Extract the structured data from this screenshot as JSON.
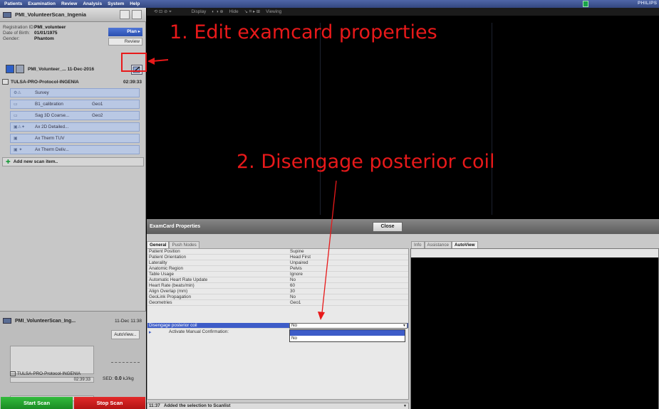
{
  "menubar": {
    "items": [
      "Patients",
      "Examination",
      "Review",
      "Analysis",
      "System",
      "Help"
    ],
    "brand": "PHILIPS"
  },
  "patient_tab": {
    "name": "PMI_VolunteerScan_Ingenia"
  },
  "registration": {
    "id_label": "Registration ID:",
    "id_value": "PMI_volunteer",
    "dob_label": "Date of Birth:",
    "dob_value": "01/01/1975",
    "gender_label": "Gender:",
    "gender_value": "Phantom"
  },
  "plan_button": "Plan ▸",
  "review_button": "Review",
  "examcard": {
    "name": "PMI_Volunteer_... 11-Dec-2016"
  },
  "protocol": {
    "name": "TULSA-PRO-Protocol-INGENIA",
    "time": "02:39:33"
  },
  "scan_items": [
    {
      "icons": "⚙⚠",
      "name": "Survey",
      "geo": ""
    },
    {
      "icons": "▭",
      "name": "B1_calibration",
      "geo": "Geo1"
    },
    {
      "icons": "▭",
      "name": "Sag 3D Coarse...",
      "geo": "Geo2"
    },
    {
      "icons": "▣⚠✦",
      "name": "Ax 2D Detailed...",
      "geo": ""
    },
    {
      "icons": "▣",
      "name": "Ax Therm TUV",
      "geo": ""
    },
    {
      "icons": "▣ ✦",
      "name": "Ax Therm Deliv...",
      "geo": ""
    }
  ],
  "add_scan_item": "Add new scan item..",
  "lower_panel": {
    "title": "PMI_VolunteerScan_Ing...",
    "time": "11-Dec 11:38",
    "autoview": "AutoView...",
    "protocol": "TULSA-PRO-Protocol-INGENIA",
    "bar_time": "02:39:33",
    "sed_label": "SED:",
    "sed_value": "0.0",
    "sed_unit": "kJ/kg"
  },
  "start_scan": "Start Scan",
  "stop_scan": "Stop Scan",
  "toolbar": {
    "display": "Display",
    "hide": "Hide",
    "viewing": "Viewing"
  },
  "examcard_properties": {
    "title": "ExamCard Properties",
    "close": "Close",
    "tabs": [
      "General",
      "Push Nodes"
    ],
    "right_tabs": [
      "Info",
      "Assistance",
      "AutoView"
    ],
    "rows": [
      {
        "key": "Patient Position",
        "value": "Supine"
      },
      {
        "key": "Patient Orientation",
        "value": "Head First"
      },
      {
        "key": "Laterality",
        "value": "Unpaired"
      },
      {
        "key": "Anatomic Region",
        "value": "Pelvis"
      },
      {
        "key": "Table Usage",
        "value": "Ignore"
      },
      {
        "key": "Automatic Heart Rate Update",
        "value": "No"
      },
      {
        "key": "Heart Rate (beats/min)",
        "value": "60"
      },
      {
        "key": "Align Overlap (mm)",
        "value": "30"
      },
      {
        "key": "GeoLink Propagation",
        "value": "No"
      },
      {
        "key": "Geometries",
        "value": "Geo1"
      }
    ],
    "selected_row": {
      "key": "Disengage posterior coil",
      "value": "No"
    },
    "dropdown_options": [
      "",
      "No"
    ],
    "confirm_label": "Activate Manual Confirmation:",
    "status": {
      "time": "11:37",
      "message": "Added the selection to Scanlist"
    }
  },
  "annotations": {
    "step1": "1. Edit examcard properties",
    "step2": "2. Disengage posterior coil"
  }
}
